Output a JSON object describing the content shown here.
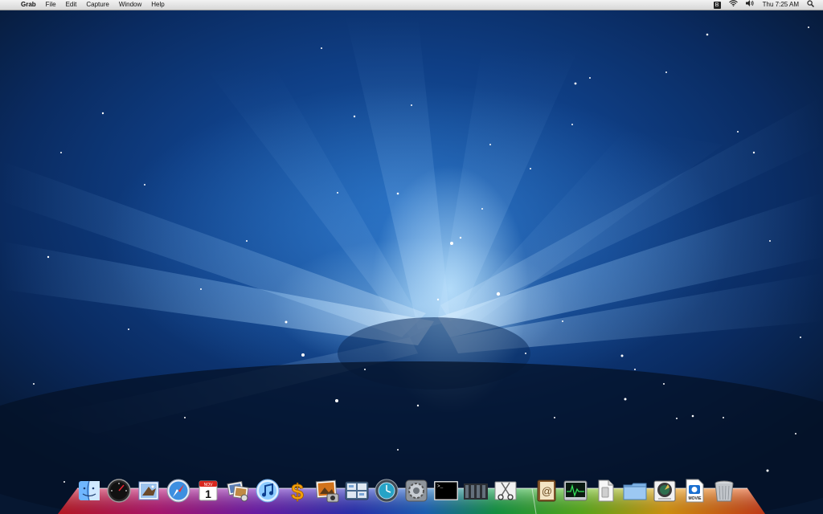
{
  "menubar": {
    "apple_symbol": "",
    "app_name": "Grab",
    "menus": [
      "File",
      "Edit",
      "Capture",
      "Window",
      "Help"
    ],
    "status": {
      "bluetooth_glyph": "B",
      "wifi_icon": "wifi-icon",
      "volume_icon": "volume-icon",
      "clock": "Thu 7:25 AM",
      "spotlight_icon": "spotlight-icon"
    }
  },
  "calendar_icon": {
    "month": "NOV",
    "day": "1"
  },
  "movie_icon": {
    "label": "MOVIE"
  },
  "dock": {
    "apps": [
      {
        "name": "Finder",
        "icon": "finder-icon"
      },
      {
        "name": "Dashboard",
        "icon": "dashboard-icon"
      },
      {
        "name": "Mail",
        "icon": "mail-icon"
      },
      {
        "name": "Safari",
        "icon": "safari-icon"
      },
      {
        "name": "iCal",
        "icon": "ical-icon"
      },
      {
        "name": "Preview",
        "icon": "preview-icon"
      },
      {
        "name": "iTunes",
        "icon": "itunes-icon"
      },
      {
        "name": "Money",
        "icon": "dollar-icon"
      },
      {
        "name": "iPhoto",
        "icon": "iphoto-icon"
      },
      {
        "name": "Spaces",
        "icon": "spaces-icon"
      },
      {
        "name": "Time Machine",
        "icon": "time-machine-icon"
      },
      {
        "name": "System Preferences",
        "icon": "system-preferences-icon"
      },
      {
        "name": "Terminal",
        "icon": "terminal-icon"
      },
      {
        "name": "Audio MIDI Setup",
        "icon": "audio-midi-icon"
      },
      {
        "name": "Grab",
        "icon": "grab-icon"
      }
    ],
    "documents": [
      {
        "name": "Address Book",
        "icon": "address-book-icon"
      },
      {
        "name": "Activity Monitor",
        "icon": "activity-monitor-icon"
      },
      {
        "name": "Document",
        "icon": "document-icon"
      },
      {
        "name": "Folder",
        "icon": "folder-icon"
      },
      {
        "name": "Disk Utility",
        "icon": "disk-utility-icon"
      },
      {
        "name": "Movie",
        "icon": "movie-file-icon"
      },
      {
        "name": "Trash",
        "icon": "trash-icon"
      }
    ]
  }
}
